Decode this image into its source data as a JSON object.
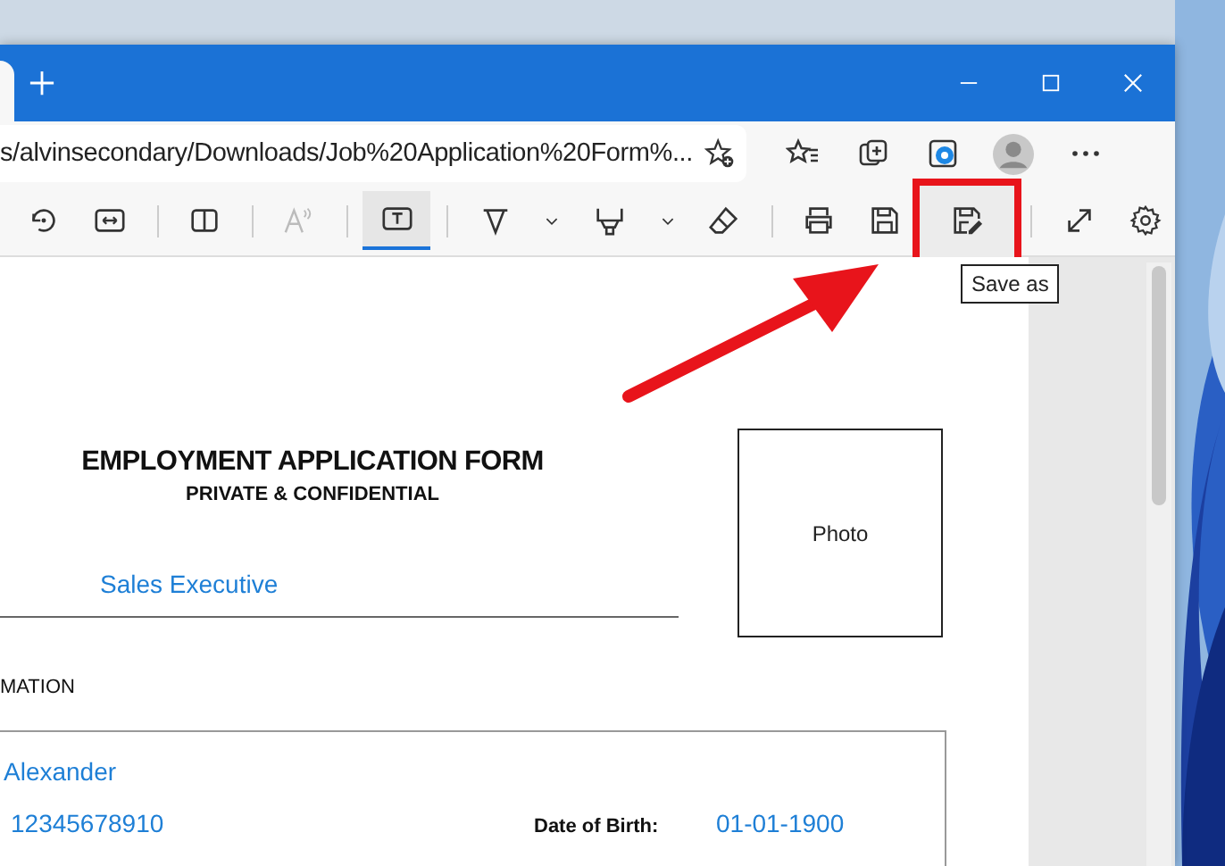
{
  "browser": {
    "tab_partial": true,
    "address": {
      "url": "s/alvinsecondary/Downloads/Job%20Application%20Form%..."
    },
    "toolbar": [
      {
        "kind": "rotate",
        "selected": false,
        "disabled": false,
        "callout": false
      },
      {
        "kind": "fit",
        "selected": false,
        "disabled": false,
        "callout": false
      },
      {
        "kind": "sep"
      },
      {
        "kind": "pageview",
        "selected": false,
        "disabled": false,
        "callout": false
      },
      {
        "kind": "sep"
      },
      {
        "kind": "read",
        "selected": false,
        "disabled": true,
        "callout": false
      },
      {
        "kind": "sep"
      },
      {
        "kind": "text",
        "selected": true,
        "disabled": false,
        "callout": false
      },
      {
        "kind": "sep"
      },
      {
        "kind": "draw",
        "selected": false,
        "disabled": false,
        "callout": false
      },
      {
        "kind": "chevron",
        "selected": false,
        "disabled": false,
        "callout": false
      },
      {
        "kind": "highlight",
        "selected": false,
        "disabled": false,
        "callout": false
      },
      {
        "kind": "chevron",
        "selected": false,
        "disabled": false,
        "callout": false
      },
      {
        "kind": "eraser",
        "selected": false,
        "disabled": false,
        "callout": false
      },
      {
        "kind": "sep"
      },
      {
        "kind": "print",
        "selected": false,
        "disabled": false,
        "callout": false
      },
      {
        "kind": "save",
        "selected": false,
        "disabled": false,
        "callout": false
      },
      {
        "kind": "saveas",
        "selected": false,
        "disabled": false,
        "callout": true
      },
      {
        "kind": "sep"
      },
      {
        "kind": "fullscreen",
        "selected": false,
        "disabled": false,
        "callout": false
      },
      {
        "kind": "settings",
        "selected": false,
        "disabled": false,
        "callout": false
      }
    ],
    "tooltip": "Save as"
  },
  "document": {
    "title": "EMPLOYMENT APPLICATION FORM",
    "subtitle": "PRIVATE & CONFIDENTIAL",
    "position": "Sales Executive",
    "photo_label": "Photo",
    "section": "MATION",
    "name": "Alexander",
    "phone": "12345678910",
    "dob_label": "Date of Birth:",
    "dob": "01-01-1900"
  }
}
